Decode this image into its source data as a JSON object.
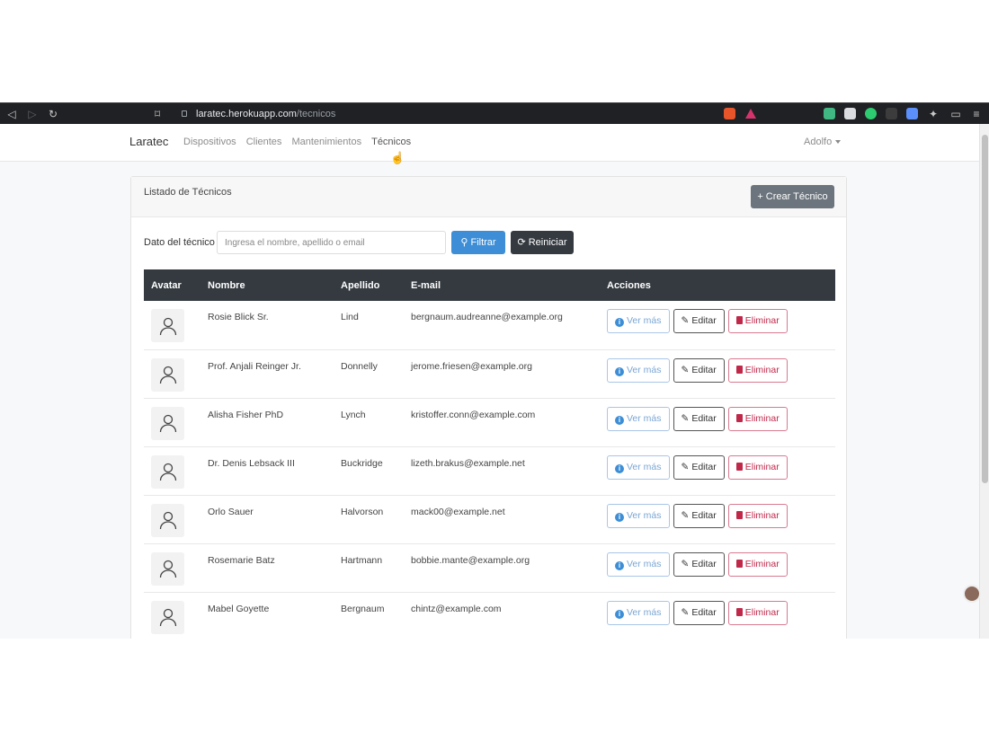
{
  "browser": {
    "url_host": "laratec.herokuapp.com",
    "url_path": "/tecnicos"
  },
  "nav": {
    "brand": "Laratec",
    "links": [
      "Dispositivos",
      "Clientes",
      "Mantenimientos",
      "Técnicos"
    ],
    "active": "Técnicos",
    "user": "Adolfo"
  },
  "card": {
    "title": "Listado de Técnicos",
    "create_label": "+ Crear Técnico"
  },
  "filter": {
    "label": "Dato del técnico",
    "placeholder": "Ingresa el nombre, apellido o email",
    "value": "",
    "filter_label": "Filtrar",
    "reset_label": "Reiniciar"
  },
  "table": {
    "headers": [
      "Avatar",
      "Nombre",
      "Apellido",
      "E-mail",
      "Acciones"
    ],
    "rows": [
      {
        "nombre": "Rosie Blick Sr.",
        "apellido": "Lind",
        "email": "bergnaum.audreanne@example.org"
      },
      {
        "nombre": "Prof. Anjali Reinger Jr.",
        "apellido": "Donnelly",
        "email": "jerome.friesen@example.org"
      },
      {
        "nombre": "Alisha Fisher PhD",
        "apellido": "Lynch",
        "email": "kristoffer.conn@example.com"
      },
      {
        "nombre": "Dr. Denis Lebsack III",
        "apellido": "Buckridge",
        "email": "lizeth.brakus@example.net"
      },
      {
        "nombre": "Orlo Sauer",
        "apellido": "Halvorson",
        "email": "mack00@example.net"
      },
      {
        "nombre": "Rosemarie Batz",
        "apellido": "Hartmann",
        "email": "bobbie.mante@example.org"
      },
      {
        "nombre": "Mabel Goyette",
        "apellido": "Bergnaum",
        "email": "chintz@example.com"
      }
    ],
    "actions": {
      "view": "Ver más",
      "edit": "Editar",
      "delete": "Eliminar"
    }
  },
  "colors": {
    "primary": "#3d8ed6",
    "dark": "#343a40",
    "secondary": "#6c757d",
    "danger": "#c0284a"
  }
}
